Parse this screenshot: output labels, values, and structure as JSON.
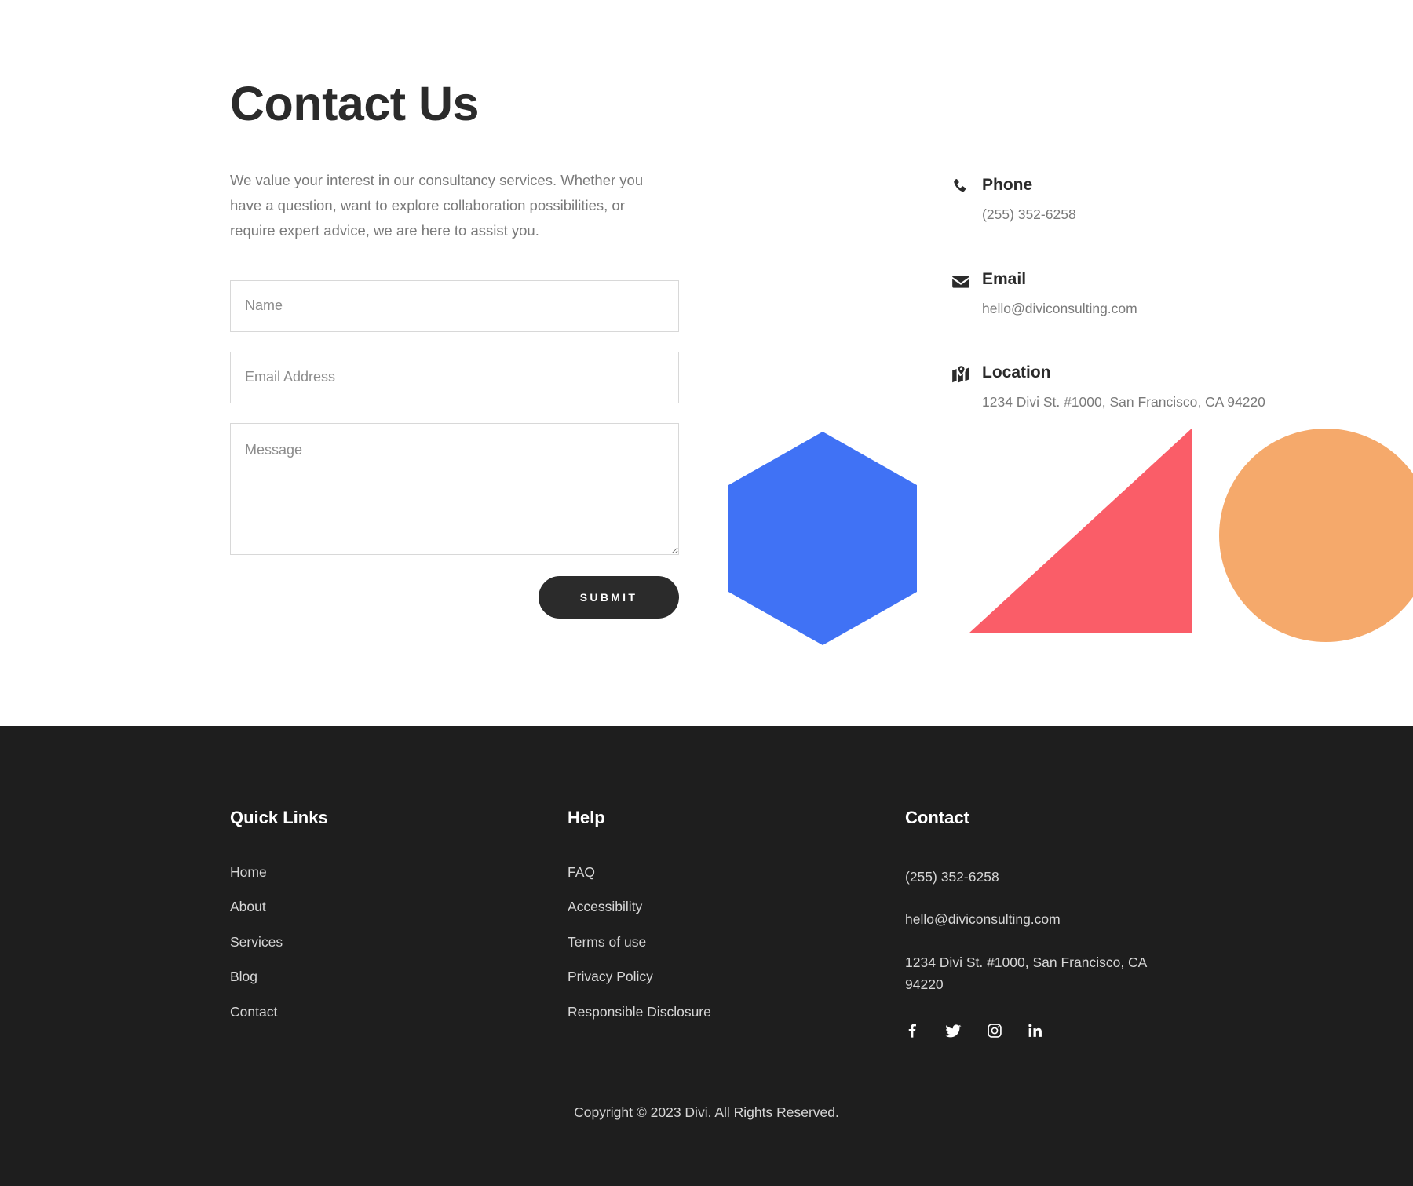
{
  "contact_section": {
    "title": "Contact Us",
    "intro": "We value your interest in our consultancy services. Whether you have a question, want to explore collaboration possibilities, or require expert advice, we are here to assist you.",
    "form": {
      "name_placeholder": "Name",
      "name_value": "",
      "email_placeholder": "Email Address",
      "email_value": "",
      "message_placeholder": "Message",
      "message_value": "",
      "submit_label": "SUBMIT"
    },
    "info": [
      {
        "icon": "phone-icon",
        "heading": "Phone",
        "value": "(255) 352-6258"
      },
      {
        "icon": "envelope-icon",
        "heading": "Email",
        "value": "hello@diviconsulting.com"
      },
      {
        "icon": "map-location-icon",
        "heading": "Location",
        "value": "1234 Divi St. #1000, San Francisco, CA 94220"
      }
    ],
    "shapes": [
      {
        "name": "hexagon",
        "color": "#4072F5"
      },
      {
        "name": "triangle",
        "color": "#FA5D68"
      },
      {
        "name": "circle",
        "color": "#F5A96B"
      }
    ]
  },
  "footer": {
    "background": "#1E1E1E",
    "quick_links": {
      "heading": "Quick Links",
      "items": [
        "Home",
        "About",
        "Services",
        "Blog",
        "Contact"
      ]
    },
    "help": {
      "heading": "Help",
      "items": [
        "FAQ",
        "Accessibility",
        "Terms of use",
        "Privacy Policy",
        "Responsible Disclosure"
      ]
    },
    "contact": {
      "heading": "Contact",
      "phone": "(255) 352-6258",
      "email": "hello@diviconsulting.com",
      "address": "1234 Divi St. #1000, San Francisco, CA 94220",
      "social": [
        "facebook-icon",
        "twitter-icon",
        "instagram-icon",
        "linkedin-icon"
      ]
    },
    "copyright": "Copyright © 2023 Divi. All Rights Reserved."
  }
}
